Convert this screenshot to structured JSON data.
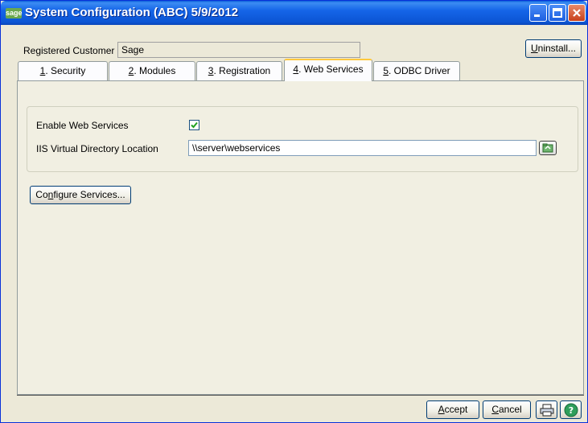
{
  "window": {
    "title": "System Configuration (ABC) 5/9/2012",
    "logo_text": "sage"
  },
  "header": {
    "registered_customer_label": "Registered Customer",
    "registered_customer_value": "Sage",
    "uninstall_prefix": "U",
    "uninstall_rest": "ninstall..."
  },
  "tabs": [
    {
      "num": "1",
      "label": ". Security"
    },
    {
      "num": "2",
      "label": ". Modules"
    },
    {
      "num": "3",
      "label": ". Registration"
    },
    {
      "num": "4",
      "label": ". Web Services"
    },
    {
      "num": "5",
      "label": ". ODBC Driver"
    }
  ],
  "active_tab": "4. Web Services",
  "web_services": {
    "enable_label": "Enable Web Services",
    "enable_checked": true,
    "iis_label": "IIS Virtual Directory Location",
    "iis_value": "\\\\server\\webservices",
    "configure_prefix": "Co",
    "configure_u": "n",
    "configure_rest": "figure Services..."
  },
  "footer": {
    "accept_u": "A",
    "accept_rest": "ccept",
    "cancel_u": "C",
    "cancel_rest": "ancel"
  },
  "icons": [
    "sage-logo",
    "minimize-icon",
    "maximize-icon",
    "close-icon",
    "folder-browse-icon",
    "printer-icon",
    "help-icon",
    "checkmark-icon"
  ]
}
